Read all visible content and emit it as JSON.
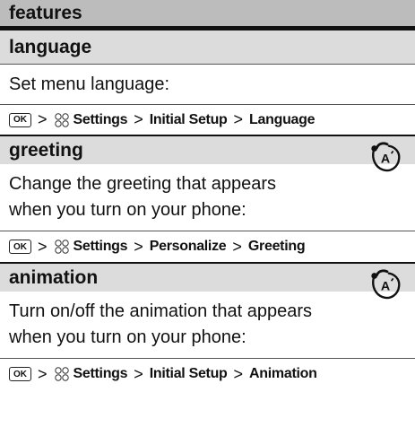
{
  "header": {
    "title": "features"
  },
  "sections": [
    {
      "title": "language",
      "text": "Set menu language:",
      "path": {
        "key_label": "OK",
        "settings_icon": "settings-icon",
        "items": [
          "Settings",
          "Initial Setup",
          "Language"
        ],
        "separator": ">"
      },
      "network_icon": false
    },
    {
      "title": "greeting",
      "text_lines": [
        "Change the greeting that appears",
        "when you turn on your phone:"
      ],
      "path": {
        "key_label": "OK",
        "settings_icon": "settings-icon",
        "items": [
          "Settings",
          "Personalize",
          "Greeting"
        ],
        "separator": ">"
      },
      "network_icon": true
    },
    {
      "title": "animation",
      "text_lines": [
        "Turn on/off the animation that appears",
        "when you turn on your phone:"
      ],
      "path": {
        "key_label": "OK",
        "settings_icon": "settings-icon",
        "items": [
          "Settings",
          "Initial Setup",
          "Animation"
        ],
        "separator": ">"
      },
      "network_icon": true
    }
  ],
  "icons": {
    "network_feature": "network-dependent-icon"
  }
}
